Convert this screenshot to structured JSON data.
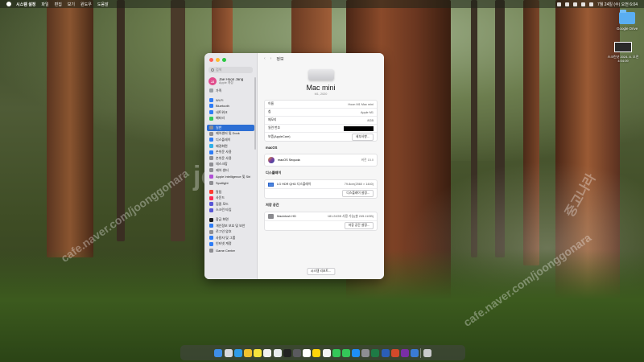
{
  "menubar": {
    "items": [
      "시스템 설정",
      "파일",
      "편집",
      "보기",
      "윈도우",
      "도움말"
    ],
    "clock": "7월 24일 (수) 오전 6:04"
  },
  "desktop": {
    "icons": [
      {
        "label": "Google Drive",
        "icon": "folder-icon"
      },
      {
        "label": "스크린샷 2024. 8. 오전 4:04:09",
        "icon": "screenshot-thumbnail-icon"
      }
    ],
    "watermarks": [
      "cafe.naver.com/joonggonara",
      "joonggonara",
      "중고나라",
      "cafe.naver.com/joonggonara"
    ]
  },
  "window": {
    "traffic_colors": [
      "#ff5f57",
      "#febc2e",
      "#28c840"
    ],
    "search_placeholder": "검색",
    "account": {
      "name": "Jae Hoon Jang",
      "subtitle": "Apple 계정",
      "initials": "JJ"
    },
    "sidebar_items": [
      {
        "label": "가족",
        "color": "#9aa0a6",
        "active": false,
        "icon": "family-icon"
      },
      {
        "label": "Wi-Fi",
        "color": "#2d7cf6",
        "active": false,
        "icon": "wifi-icon"
      },
      {
        "label": "Bluetooth",
        "color": "#2d7cf6",
        "active": false,
        "icon": "bluetooth-icon"
      },
      {
        "label": "네트워크",
        "color": "#2d7cf6",
        "active": false,
        "icon": "network-icon"
      },
      {
        "label": "배터리",
        "color": "#34c759",
        "active": false,
        "icon": "battery-icon"
      },
      {
        "label": "일반",
        "color": "#8e8e93",
        "active": true,
        "icon": "general-icon"
      },
      {
        "label": "제어센터 및 Dock",
        "color": "#8e8e93",
        "active": false,
        "icon": "control-center-icon"
      },
      {
        "label": "디스플레이",
        "color": "#2d7cf6",
        "active": false,
        "icon": "display-icon"
      },
      {
        "label": "배경화면",
        "color": "#2fb0e8",
        "active": false,
        "icon": "wallpaper-icon"
      },
      {
        "label": "손쉬운 사용",
        "color": "#2d7cf6",
        "active": false,
        "icon": "accessibility-icon"
      },
      {
        "label": "손쉬운 사용",
        "color": "#8e8e93",
        "active": false,
        "icon": "appearance-icon"
      },
      {
        "label": "데스크탑",
        "color": "#8e8e93",
        "active": false,
        "icon": "desktop-icon"
      },
      {
        "label": "제어 센터",
        "color": "#8e8e93",
        "active": false,
        "icon": "control-icon"
      },
      {
        "label": "Apple Intelligence 및 Siri",
        "color": "#b04fd6",
        "active": false,
        "icon": "siri-icon"
      },
      {
        "label": "Spotlight",
        "color": "#8e8e93",
        "active": false,
        "icon": "spotlight-icon"
      },
      {
        "label": "알림",
        "color": "#ff3b30",
        "active": false,
        "icon": "notifications-icon"
      },
      {
        "label": "사운드",
        "color": "#ff2d55",
        "active": false,
        "icon": "sound-icon"
      },
      {
        "label": "집중 모드",
        "color": "#5856d6",
        "active": false,
        "icon": "focus-icon"
      },
      {
        "label": "스크린 타임",
        "color": "#5856d6",
        "active": false,
        "icon": "screen-time-icon"
      },
      {
        "label": "잠금 화면",
        "color": "#1c1c1e",
        "active": false,
        "icon": "lock-screen-icon"
      },
      {
        "label": "개인정보 보호 및 보안",
        "color": "#2d7cf6",
        "active": false,
        "icon": "privacy-icon"
      },
      {
        "label": "로그인 암호",
        "color": "#8e8e93",
        "active": false,
        "icon": "login-password-icon"
      },
      {
        "label": "사용자 및 그룹",
        "color": "#2d7cf6",
        "active": false,
        "icon": "users-icon"
      },
      {
        "label": "인터넷 계정",
        "color": "#2d7cf6",
        "active": false,
        "icon": "internet-accounts-icon"
      },
      {
        "label": "Game Center",
        "color": "#8e8e93",
        "active": false,
        "icon": "game-center-icon"
      }
    ],
    "header": {
      "back": "‹",
      "forward": "›",
      "title": "정보"
    },
    "device": {
      "model": "Mac mini",
      "year": "M1, 2020"
    },
    "specs": [
      {
        "label": "이름",
        "value": "Hoon M1 Mac mini"
      },
      {
        "label": "칩",
        "value": "Apple M1"
      },
      {
        "label": "메모리",
        "value": "8GB"
      },
      {
        "label": "일련 번호",
        "value": ""
      },
      {
        "label": "보증(AppleCare)",
        "value": "세부사항..."
      }
    ],
    "macos_section": "macOS",
    "macos": {
      "name": "macOS Sequoia",
      "version": "버전 15.0"
    },
    "display_section": "디스플레이",
    "display": {
      "name": "LG HDR QHD 디스플레이",
      "resolution": "79.8cm(2560 × 1440)",
      "button": "디스플레이 설정..."
    },
    "storage_section": "저장 공간",
    "storage": {
      "name": "Macintosh HD",
      "info": "181.24GB 사용 가능(총 245.11GB)",
      "button": "저장 공간 설정..."
    },
    "bottom_button": "시스템 리포트..."
  },
  "dock": {
    "apps": [
      {
        "name": "finder-icon",
        "color": "#3f8ee8"
      },
      {
        "name": "launchpad-icon",
        "color": "#d9d9de"
      },
      {
        "name": "safari-icon",
        "color": "#2f9be8"
      },
      {
        "name": "chrome-icon",
        "color": "#f2c12e"
      },
      {
        "name": "kakaotalk-icon",
        "color": "#f7e33c"
      },
      {
        "name": "photos-icon",
        "color": "#f2f2f2"
      },
      {
        "name": "appstore-icon",
        "color": "#e9ecef"
      },
      {
        "name": "finalcut-icon",
        "color": "#222222"
      },
      {
        "name": "quicktime-icon",
        "color": "#5a5a5e"
      },
      {
        "name": "calendar-icon",
        "color": "#ffffff"
      },
      {
        "name": "notes-icon",
        "color": "#ffd60a"
      },
      {
        "name": "reminders-icon",
        "color": "#f5f5f5"
      },
      {
        "name": "facetime-icon",
        "color": "#34c759"
      },
      {
        "name": "messages-icon",
        "color": "#34c759"
      },
      {
        "name": "appstore2-icon",
        "color": "#1e8ef7"
      },
      {
        "name": "settings-icon",
        "color": "#8e8e93"
      },
      {
        "name": "excel-icon",
        "color": "#1e7a45"
      },
      {
        "name": "word-icon",
        "color": "#2b5eb8"
      },
      {
        "name": "powerpoint-icon",
        "color": "#d2492a"
      },
      {
        "name": "onenote-icon",
        "color": "#7a2ea6"
      },
      {
        "name": "xcode-icon",
        "color": "#3a7bd5"
      },
      {
        "name": "trash-icon",
        "color": "#c9c9cc"
      }
    ]
  }
}
